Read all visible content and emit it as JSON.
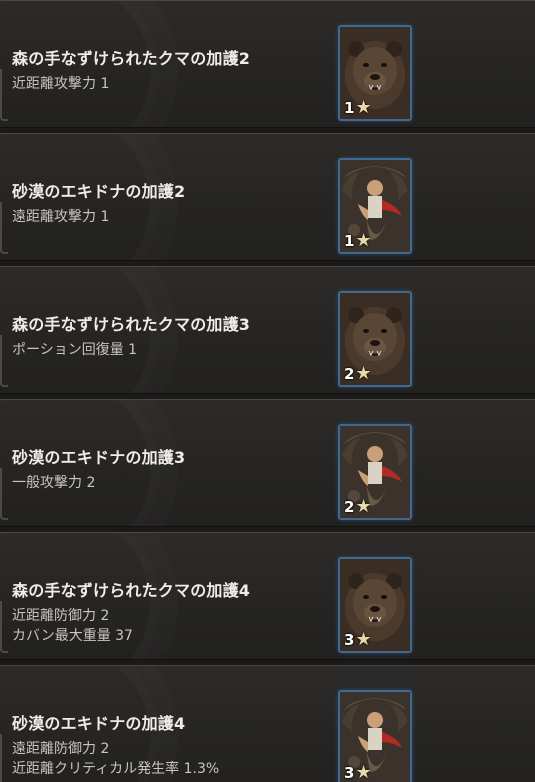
{
  "cards": [
    {
      "title": "森の手なずけられたクマの加護2",
      "stats": [
        "近距離攻撃力 1"
      ],
      "image": "bear-portrait",
      "level": "1"
    },
    {
      "title": "砂漠のエキドナの加護2",
      "stats": [
        "遠距離攻撃力 1"
      ],
      "image": "echidna-portrait",
      "level": "1"
    },
    {
      "title": "森の手なずけられたクマの加護3",
      "stats": [
        "ポーション回復量 1"
      ],
      "image": "bear-portrait",
      "level": "2"
    },
    {
      "title": "砂漠のエキドナの加護3",
      "stats": [
        "一般攻撃力 2"
      ],
      "image": "echidna-portrait",
      "level": "2"
    },
    {
      "title": "森の手なずけられたクマの加護4",
      "stats": [
        "近距離防御力 2",
        "カバン最大重量 37"
      ],
      "image": "bear-portrait",
      "level": "3"
    },
    {
      "title": "砂漠のエキドナの加護4",
      "stats": [
        "遠距離防御力 2",
        "近距離クリティカル発生率 1.3%"
      ],
      "image": "echidna-portrait",
      "level": "3"
    }
  ],
  "star_glyph": "★",
  "colors": {
    "card_border_accent": "#3d6a92",
    "title_text": "#f0ede8",
    "stat_text": "#c9c5bf",
    "star": "#e8d7a8"
  }
}
